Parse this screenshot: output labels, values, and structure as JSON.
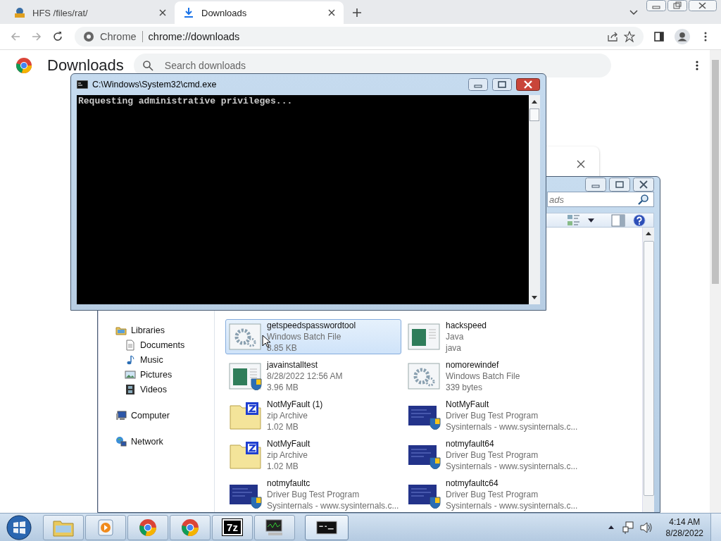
{
  "browser": {
    "tabs": [
      {
        "title": "HFS /files/rat/",
        "kind": "web_page",
        "selected": false
      },
      {
        "title": "Downloads",
        "kind": "downloads_page",
        "selected": true
      }
    ],
    "address": {
      "label": "Chrome",
      "url": "chrome://downloads"
    },
    "page": {
      "title": "Downloads",
      "search_placeholder": "Search downloads"
    }
  },
  "cmd": {
    "title": "C:\\Windows\\System32\\cmd.exe",
    "lines": [
      "Requesting administrative privileges..."
    ]
  },
  "explorer": {
    "search_placeholder": "ads",
    "nav": [
      {
        "label": "Libraries",
        "kind": "libraries",
        "children": [
          {
            "label": "Documents",
            "kind": "documents"
          },
          {
            "label": "Music",
            "kind": "music"
          },
          {
            "label": "Pictures",
            "kind": "pictures"
          },
          {
            "label": "Videos",
            "kind": "videos"
          }
        ]
      },
      {
        "label": "Computer",
        "kind": "computer"
      },
      {
        "label": "Network",
        "kind": "network"
      }
    ],
    "files": [
      {
        "name": "getspeedspasswordtool",
        "line_2": "Windows Batch File",
        "line_3": "8.85 KB",
        "kind": "batch",
        "selected": true
      },
      {
        "name": "hackspeed",
        "line_2": "Java",
        "line_3": "java",
        "kind": "java",
        "selected": false
      },
      {
        "name": "javainstalltest",
        "line_2": "8/28/2022 12:56 AM",
        "line_3": "3.96 MB",
        "kind": "java_setup",
        "selected": false
      },
      {
        "name": "nomorewindef",
        "line_2": "Windows Batch File",
        "line_3": "339 bytes",
        "kind": "batch",
        "selected": false
      },
      {
        "name": "NotMyFault (1)",
        "line_2": "zip Archive",
        "line_3": "1.02 MB",
        "kind": "zip",
        "selected": false
      },
      {
        "name": "NotMyFault",
        "line_2": "Driver Bug Test Program",
        "line_3": "Sysinternals - www.sysinternals.c...",
        "kind": "program",
        "selected": false
      },
      {
        "name": "NotMyFault",
        "line_2": "zip Archive",
        "line_3": "1.02 MB",
        "kind": "zip",
        "selected": false
      },
      {
        "name": "notmyfault64",
        "line_2": "Driver Bug Test Program",
        "line_3": "Sysinternals - www.sysinternals.c...",
        "kind": "program",
        "selected": false
      },
      {
        "name": "notmyfaultc",
        "line_2": "Driver Bug Test Program",
        "line_3": "Sysinternals - www.sysinternals.c...",
        "kind": "program",
        "selected": false
      },
      {
        "name": "notmyfaultc64",
        "line_2": "Driver Bug Test Program",
        "line_3": "Sysinternals - www.sysinternals.c...",
        "kind": "program",
        "selected": false
      }
    ]
  },
  "taskbar": {
    "apps": [
      {
        "kind": "explorer",
        "active": false
      },
      {
        "kind": "media_player",
        "active": false
      },
      {
        "kind": "chrome",
        "active": false
      },
      {
        "kind": "chrome",
        "active": false
      },
      {
        "kind": "archiver",
        "label": "7z",
        "active": false
      },
      {
        "kind": "monitor",
        "active": false
      },
      {
        "kind": "cmd",
        "active": true
      }
    ],
    "clock": {
      "time": "4:14 AM",
      "date": "8/28/2022"
    }
  }
}
